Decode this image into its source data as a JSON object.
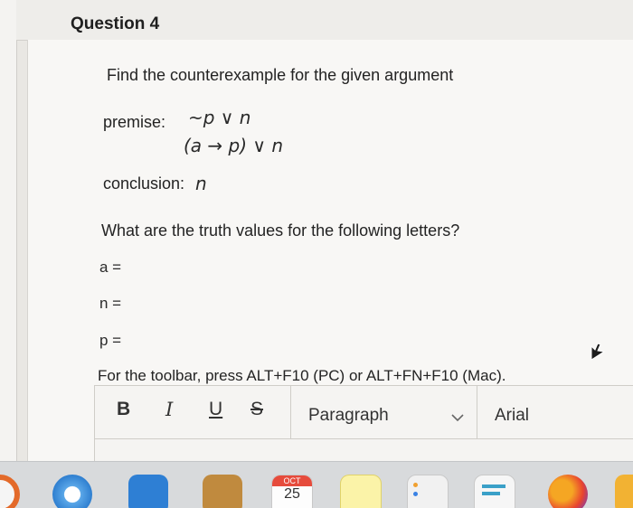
{
  "question": {
    "title": "Question 4",
    "prompt": "Find the counterexample for the given argument",
    "premise_label": "premise:",
    "premise_1": "~p ∨ n",
    "premise_2": "(a → p) ∨ n",
    "conclusion_label": "conclusion:",
    "conclusion_value": "n",
    "sub_prompt": "What are the truth values for the following letters?",
    "answers": [
      {
        "label": "a ="
      },
      {
        "label": "n ="
      },
      {
        "label": "p ="
      }
    ],
    "toolbar_hint": "For the toolbar, press ALT+F10 (PC) or ALT+FN+F10 (Mac)."
  },
  "editor": {
    "bold": "B",
    "italic": "I",
    "underline": "U",
    "strike": "S",
    "paragraph": "Paragraph",
    "font": "Arial"
  },
  "dock": {
    "calendar_month": "OCT",
    "calendar_day": "25"
  },
  "colors": {
    "page_bg": "#f8f7f5",
    "dock_bg": "#d8dadc"
  }
}
